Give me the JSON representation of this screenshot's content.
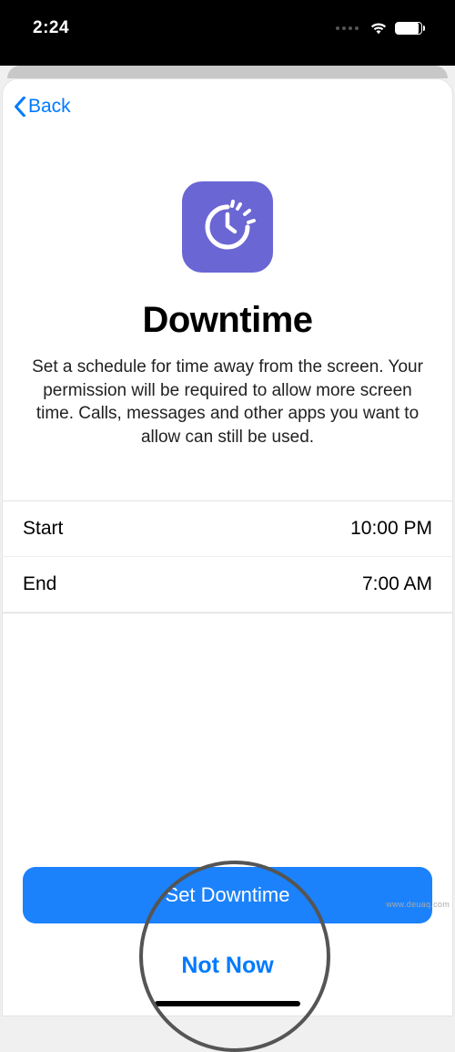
{
  "status": {
    "time": "2:24"
  },
  "nav": {
    "back_label": "Back"
  },
  "header": {
    "title": "Downtime",
    "description": "Set a schedule for time away from the screen. Your permission will be required to allow more screen time. Calls, messages and other apps you want to allow can still be used."
  },
  "schedule": {
    "start_label": "Start",
    "start_value": "10:00 PM",
    "end_label": "End",
    "end_value": "7:00 AM"
  },
  "footer": {
    "primary_label": "Set Downtime",
    "secondary_label": "Not Now"
  },
  "watermark": "www.deuaq.com"
}
